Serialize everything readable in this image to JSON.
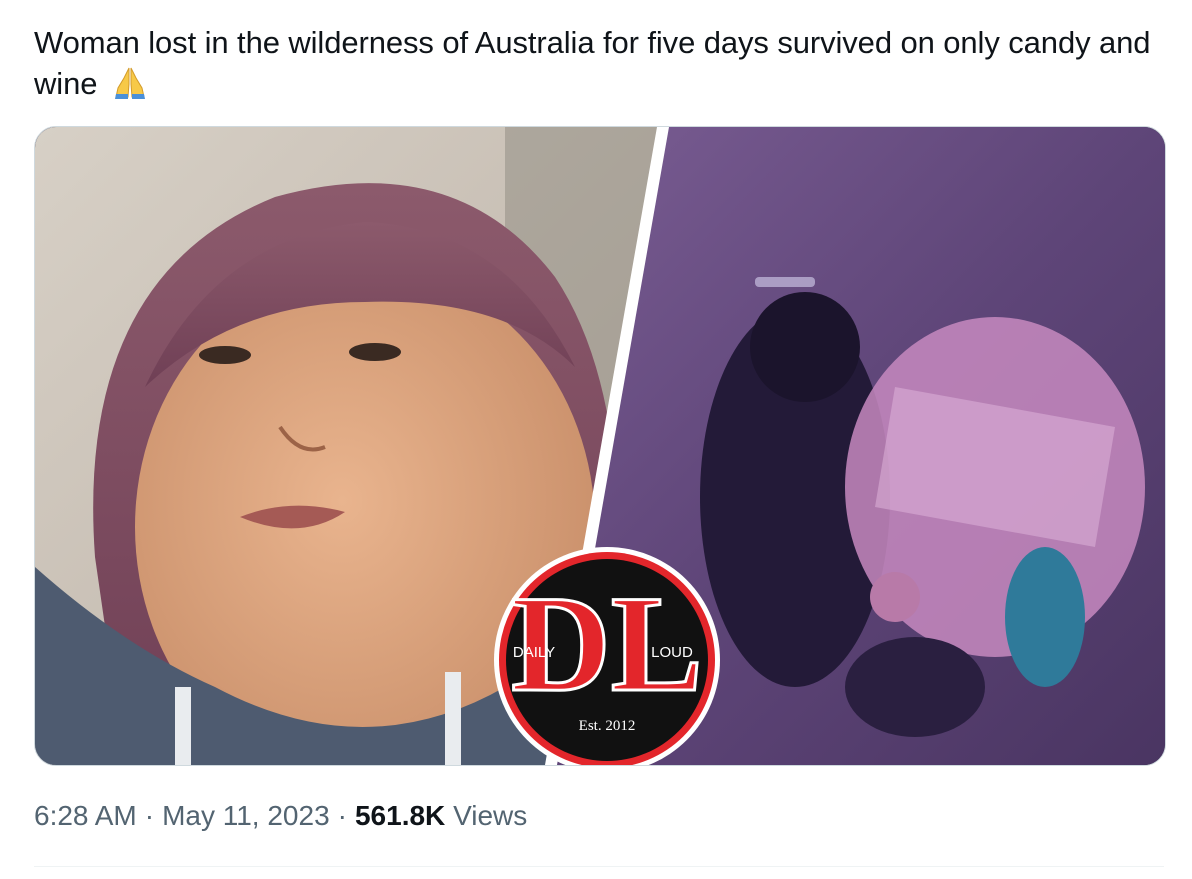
{
  "tweet": {
    "text": "Woman lost in the wilderness of Australia for five days survived on only candy and wine",
    "emoji": "folded-hands-emoji"
  },
  "media": {
    "logo": {
      "left_word": "DAILY",
      "right_word": "LOUD",
      "monogram": "DL",
      "established": "Est. 2012"
    },
    "colors": {
      "logo_red": "#e3262b",
      "logo_black": "#111111",
      "left_photo_bg": "#cfc6bd",
      "right_photo_bg": "#6b4f86"
    }
  },
  "meta": {
    "time": "6:28 AM",
    "separator": "·",
    "date": "May 11, 2023",
    "views_count": "561.8K",
    "views_label": "Views"
  }
}
